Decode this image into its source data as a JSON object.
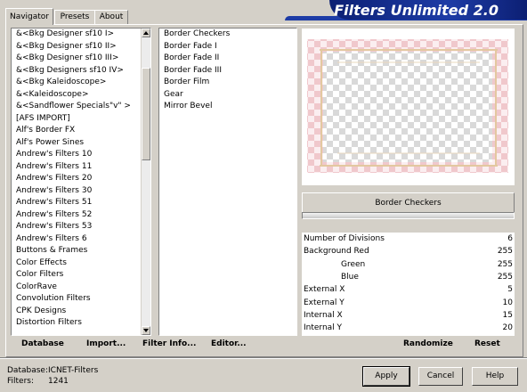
{
  "tabs": {
    "navigator": "Navigator",
    "presets": "Presets",
    "about": "About"
  },
  "app": {
    "title": "Filters Unlimited 2.0"
  },
  "categories": [
    "&<Bkg Designer sf10 I>",
    "&<Bkg Designer sf10 II>",
    "&<Bkg Designer sf10 III>",
    "&<Bkg Designers sf10 IV>",
    "&<Bkg Kaleidoscope>",
    "&<Kaleidoscope>",
    "&<Sandflower Specials\"v\" >",
    "[AFS IMPORT]",
    "Alf's Border FX",
    "Alf's Power Sines",
    "Andrew's Filters 10",
    "Andrew's Filters 11",
    "Andrew's Filters 20",
    "Andrew's Filters 30",
    "Andrew's Filters 51",
    "Andrew's Filters 52",
    "Andrew's Filters 53",
    "Andrew's Filters 6",
    "Buttons & Frames",
    "Color Effects",
    "Color Filters",
    "ColorRave",
    "Convolution Filters",
    "CPK Designs",
    "Distortion Filters"
  ],
  "filters": [
    "Border Checkers",
    "Border Fade I",
    "Border Fade II",
    "Border Fade III",
    "Border Film",
    "Gear",
    "Mirror Bevel"
  ],
  "selected_filter": "Border Checkers",
  "params": [
    {
      "label": "Number of Divisions",
      "value": "6"
    },
    {
      "label": "Background Red",
      "value": "255"
    },
    {
      "label": "Green",
      "value": "255"
    },
    {
      "label": "Blue",
      "value": "255"
    },
    {
      "label": "External X",
      "value": "5"
    },
    {
      "label": "External Y",
      "value": "10"
    },
    {
      "label": "Internal X",
      "value": "15"
    },
    {
      "label": "Internal Y",
      "value": "20"
    }
  ],
  "buttons": {
    "database": "Database",
    "import": "Import...",
    "filter_info": "Filter Info...",
    "editor": "Editor...",
    "randomize": "Randomize",
    "reset": "Reset",
    "apply": "Apply",
    "cancel": "Cancel",
    "help": "Help"
  },
  "status": {
    "database_label": "Database:",
    "database_value": "ICNET-Filters",
    "filters_label": "Filters:",
    "filters_value": "1241"
  },
  "colors": {
    "banner": "#1e3ca6",
    "checker_pink": "#f0c8cc",
    "checker_gray": "#d9d9d9"
  },
  "icons": {
    "scroll_up": "triangle-up",
    "scroll_down": "triangle-down"
  }
}
